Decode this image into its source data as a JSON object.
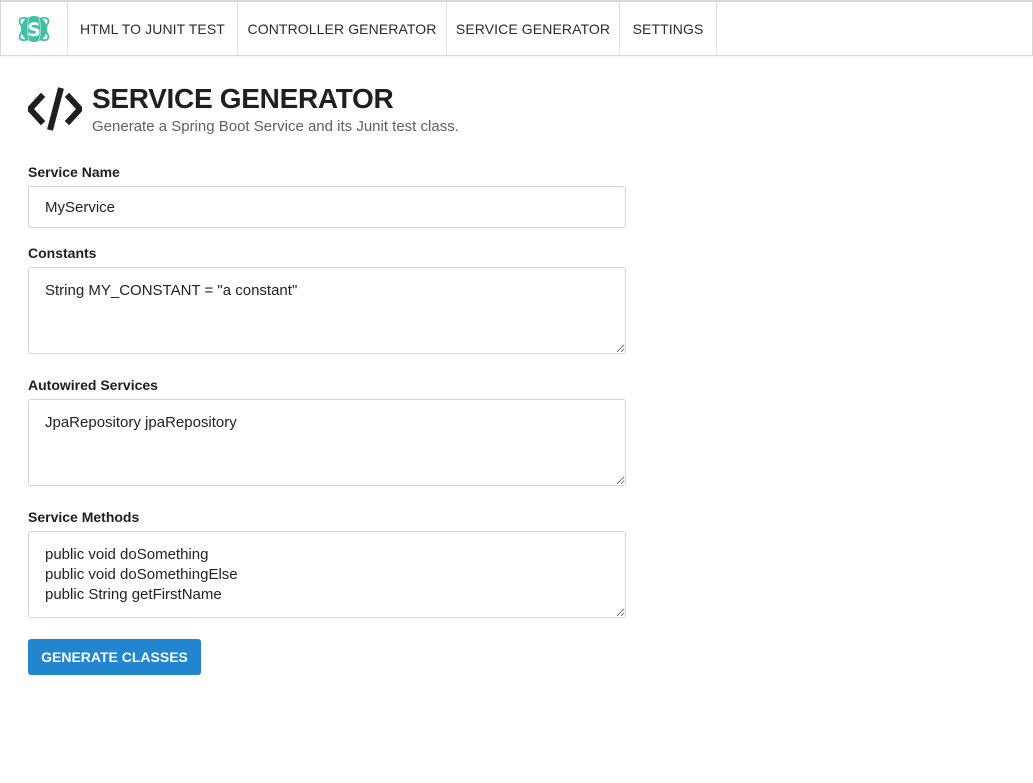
{
  "nav": {
    "logo_icon": "atom-s-logo-icon",
    "items": [
      {
        "label": "HTML TO JUNIT TEST"
      },
      {
        "label": "CONTROLLER GENERATOR"
      },
      {
        "label": "SERVICE GENERATOR"
      },
      {
        "label": "SETTINGS"
      }
    ]
  },
  "header": {
    "icon": "code-icon",
    "title": "SERVICE GENERATOR",
    "subtitle": "Generate a Spring Boot Service and its Junit test class."
  },
  "form": {
    "service_name": {
      "label": "Service Name",
      "value": "MyService"
    },
    "constants": {
      "label": "Constants",
      "value": "String MY_CONSTANT = \"a constant\""
    },
    "autowired": {
      "label": "Autowired Services",
      "value": "JpaRepository jpaRepository"
    },
    "methods": {
      "label": "Service Methods",
      "value": "public void doSomething\npublic void doSomethingElse\npublic String getFirstName"
    },
    "submit_label": "GENERATE CLASSES"
  },
  "colors": {
    "accent": "#2185d0",
    "logo": "#3fbfa5"
  }
}
